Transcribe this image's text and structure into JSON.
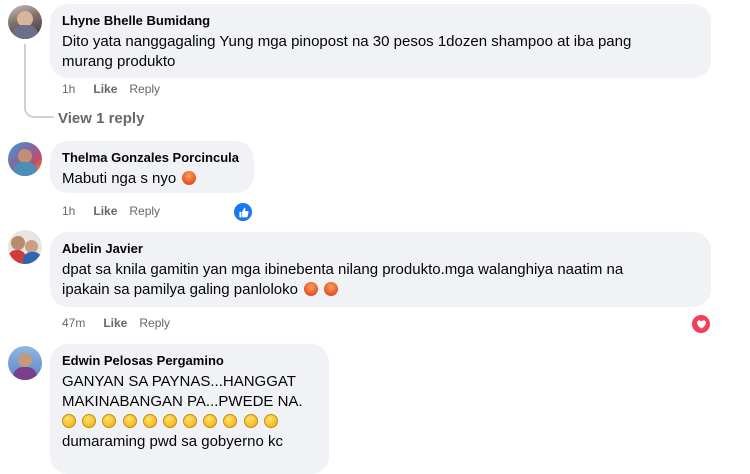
{
  "comments": [
    {
      "author": "Lhyne Bhelle Bumidang",
      "text_line1": "Dito yata nanggagaling Yung mga pinopost na 30 pesos 1dozen shampoo at iba pang",
      "text_line2": "murang produkto",
      "time": "1h",
      "like": "Like",
      "reply": "Reply",
      "view_replies": "View 1 reply"
    },
    {
      "author": "Thelma Gonzales Porcincula",
      "text": "Mabuti nga s nyo",
      "time": "1h",
      "like": "Like",
      "reply": "Reply",
      "reaction": "like-reaction-icon"
    },
    {
      "author": "Abelin Javier",
      "text_line1": "dpat sa knila gamitin yan mga ibinebenta nilang produkto.mga walanghiya naatim na",
      "text_line2": "ipakain sa pamilya galing panloloko",
      "time": "47m",
      "like": "Like",
      "reply": "Reply",
      "reaction": "love-reaction-icon"
    },
    {
      "author": "Edwin Pelosas Pergamino",
      "text_line1": "GANYAN SA PAYNAS...HANGGAT",
      "text_line2": "MAKINABANGAN PA...PWEDE NA.",
      "text_line4": "dumaraming pwd sa gobyerno kc"
    }
  ],
  "colors": {
    "bubble": "#f0f2f5",
    "muted": "#65676b",
    "like_blue": "#1877f2",
    "love_red": "#f33e58"
  }
}
